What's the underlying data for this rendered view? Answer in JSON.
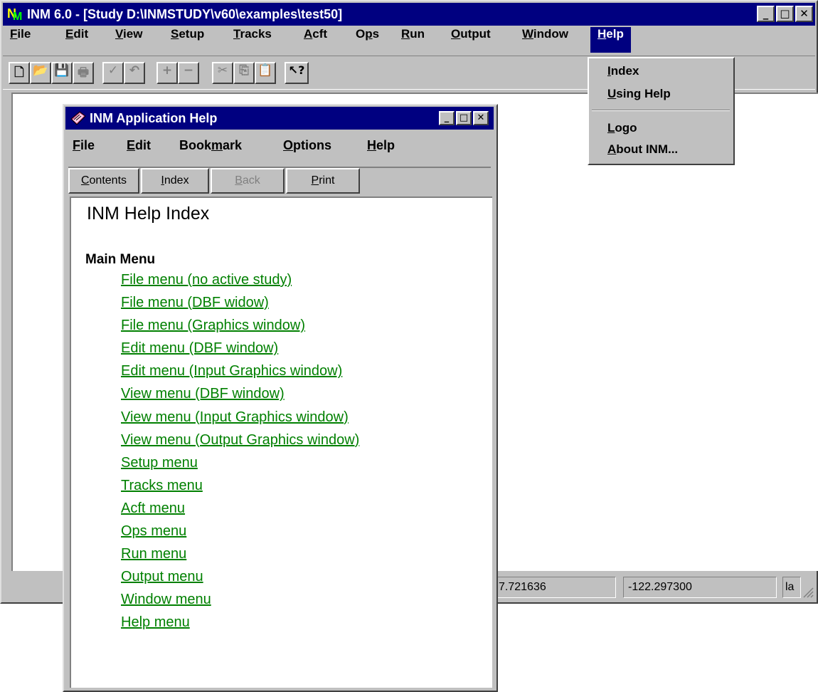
{
  "main_window": {
    "title": "INM 6.0 - [Study D:\\INMSTUDY\\v60\\examples\\test50]",
    "title_icon_letters": [
      "N",
      "M"
    ],
    "window_buttons": {
      "minimize": "_",
      "maximize": "□",
      "close": "✕"
    },
    "menu": [
      {
        "underline": "F",
        "rest": "ile"
      },
      {
        "underline": "E",
        "rest": "dit"
      },
      {
        "underline": "V",
        "rest": "iew"
      },
      {
        "underline": "S",
        "rest": "etup"
      },
      {
        "underline": "T",
        "rest": "racks"
      },
      {
        "underline": "A",
        "rest": "cft"
      },
      {
        "before": "O",
        "underline": "p",
        "rest": "s"
      },
      {
        "underline": "R",
        "rest": "un"
      },
      {
        "underline": "O",
        "rest": "utput"
      },
      {
        "underline": "W",
        "rest": "indow"
      },
      {
        "underline": "H",
        "rest": "elp"
      }
    ],
    "toolbar": {
      "new": "🗋",
      "open": "📂",
      "save": "💾",
      "print": "🖶",
      "check": "✓",
      "undo": "↶",
      "add": "+",
      "remove": "−",
      "cut": "✂",
      "copy": "⎘",
      "paste": "📋",
      "context_help": "↖?"
    },
    "status": {
      "latitude": "7.721636",
      "longitude": "-122.297300",
      "last": "la"
    }
  },
  "help_dropdown": {
    "items": [
      {
        "underline": "I",
        "rest": "ndex"
      },
      {
        "underline": "U",
        "rest": "sing Help"
      },
      {
        "underline": "L",
        "rest": "ogo"
      },
      {
        "underline": "A",
        "rest": "bout INM..."
      }
    ]
  },
  "help_window": {
    "title": "INM Application Help",
    "title_icon": "book-icon",
    "menu": [
      {
        "underline": "F",
        "rest": "ile"
      },
      {
        "underline": "E",
        "rest": "dit"
      },
      {
        "before": "Book",
        "underline": "m",
        "rest": "ark"
      },
      {
        "underline": "O",
        "rest": "ptions"
      },
      {
        "underline": "H",
        "rest": "elp"
      }
    ],
    "buttons": [
      {
        "underline": "C",
        "rest": "ontents"
      },
      {
        "underline": "I",
        "rest": "ndex"
      },
      {
        "underline": "B",
        "rest": "ack"
      },
      {
        "underline": "P",
        "rest": "rint"
      }
    ],
    "index_title": "INM Help Index",
    "section_heading": "Main Menu",
    "links": [
      "File menu (no active study)",
      "File menu (DBF widow)",
      "File menu (Graphics window)",
      "Edit menu (DBF window)",
      "Edit menu (Input Graphics window)",
      "View menu (DBF window)",
      "View menu (Input Graphics window)",
      "View menu (Output Graphics window)",
      "Setup menu",
      "Tracks menu",
      "Acft menu",
      "Ops menu",
      "Run menu",
      "Output menu",
      "Window menu",
      "Help menu"
    ]
  },
  "colors": {
    "title_bar": "#000080",
    "window_face": "#c0c0c0",
    "link": "#008000"
  }
}
